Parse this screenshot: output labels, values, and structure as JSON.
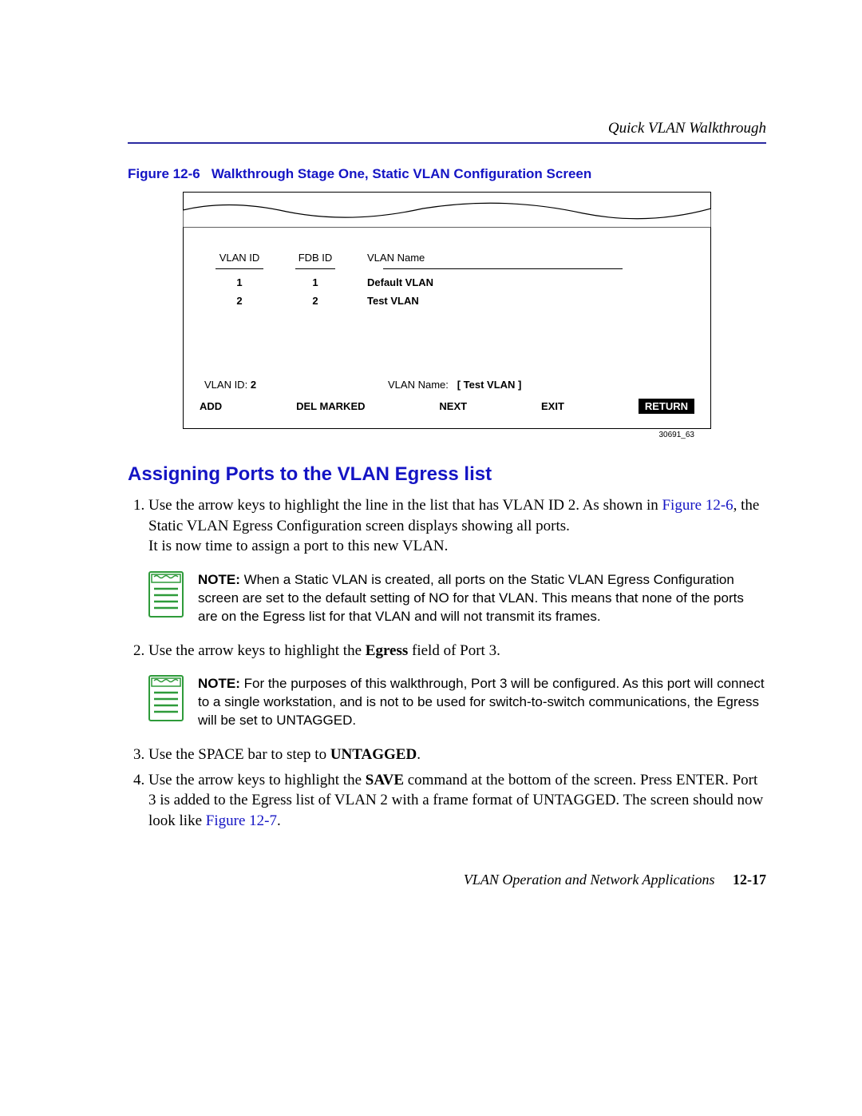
{
  "header": {
    "title": "Quick VLAN Walkthrough"
  },
  "figure": {
    "caption_prefix": "Figure 12-6",
    "caption_title": "Walkthrough Stage One, Static VLAN Configuration Screen",
    "columns": {
      "a": "VLAN ID",
      "b": "FDB ID",
      "c": "VLAN Name"
    },
    "rows": [
      {
        "a": "1",
        "b": "1",
        "c": "Default VLAN"
      },
      {
        "a": "2",
        "b": "2",
        "c": "Test VLAN"
      }
    ],
    "vlan_id_label": "VLAN ID:",
    "vlan_id_value": "2",
    "vlan_name_label": "VLAN Name:",
    "vlan_name_value": "[ Test VLAN ]",
    "buttons": {
      "add": "ADD",
      "del": "DEL MARKED",
      "next": "NEXT",
      "exit": "EXIT",
      "ret": "RETURN"
    },
    "id": "30691_63"
  },
  "section_title": "Assigning Ports to the VLAN Egress list",
  "step1_a": "Use the arrow keys to highlight the line in the list that has VLAN ID 2. As shown in ",
  "step1_link": "Figure 12-6",
  "step1_b": ", the Static VLAN Egress Configuration screen displays showing all ports.",
  "step1_c": "It is now time to assign a port to this new VLAN.",
  "note1_label": "NOTE:",
  "note1_text": " When a Static VLAN is created, all ports on the Static VLAN Egress Configuration screen are set to the default setting of NO for that VLAN. This means that none of the ports are on the Egress list for that VLAN and will not transmit its frames.",
  "step2_a": "Use the arrow keys to highlight the ",
  "step2_b1": "Egress",
  "step2_c": " field of Port 3.",
  "note2_label": "NOTE:",
  "note2_text": " For the purposes of this walkthrough, Port 3 will be configured. As this port will connect to a single workstation, and is not to be used for switch-to-switch communications, the Egress will be set to UNTAGGED.",
  "step3_a": "Use the SPACE bar to step to ",
  "step3_b1": "UNTAGGED",
  "step3_c": ".",
  "step4_a": "Use the arrow keys to highlight the ",
  "step4_b1": "SAVE",
  "step4_b": " command at the bottom of the screen. Press ENTER. Port 3 is added to the Egress list of VLAN 2 with a frame format of UNTAGGED. The screen should now look like ",
  "step4_link": "Figure 12-7",
  "step4_c": ".",
  "footer": {
    "book": "VLAN Operation and Network Applications",
    "page": "12-17"
  }
}
